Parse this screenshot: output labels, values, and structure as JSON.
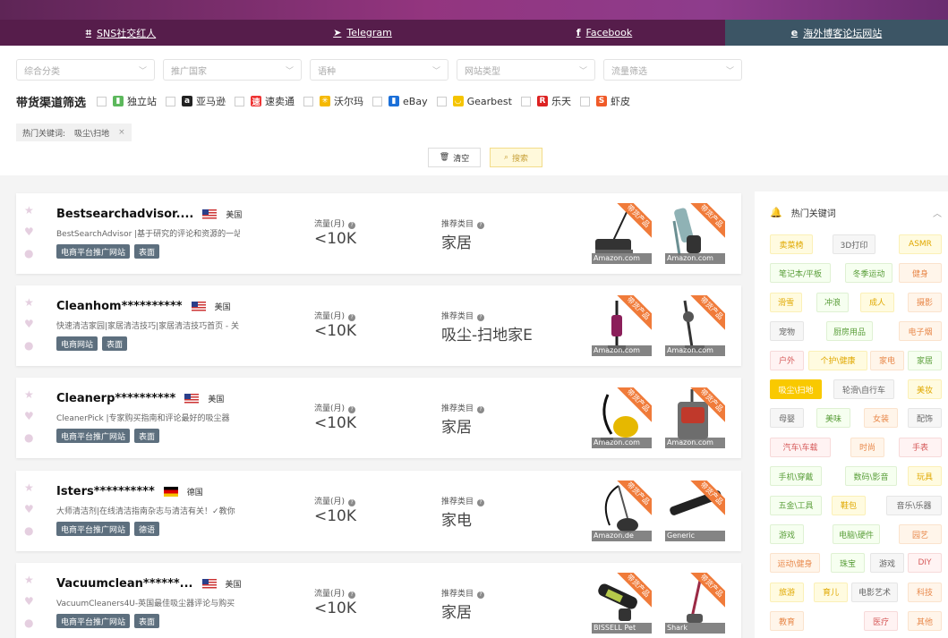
{
  "tabs": [
    {
      "label": "SNS社交红人",
      "icon": "⌗"
    },
    {
      "label": "Telegram",
      "icon": "➤"
    },
    {
      "label": "Facebook",
      "icon": "f"
    },
    {
      "label": "海外博客论坛网站",
      "icon": "e"
    }
  ],
  "filters": {
    "selects": [
      "综合分类",
      "推广国家",
      "语种",
      "网站类型",
      "流量筛选"
    ],
    "channel_label": "带货渠道筛选",
    "channels": [
      {
        "label": "独立站",
        "color": "#5cb85c",
        "glyph": "▮"
      },
      {
        "label": "亚马逊",
        "color": "#222",
        "glyph": "a"
      },
      {
        "label": "速卖通",
        "color": "#e33",
        "glyph": "速"
      },
      {
        "label": "沃尔玛",
        "color": "#f5b800",
        "glyph": "✳"
      },
      {
        "label": "eBay",
        "color": "#1b6fd8",
        "glyph": "▮"
      },
      {
        "label": "Gearbest",
        "color": "#f5c400",
        "glyph": "◡"
      },
      {
        "label": "乐天",
        "color": "#d22",
        "glyph": "R"
      },
      {
        "label": "虾皮",
        "color": "#f05a28",
        "glyph": "S"
      }
    ],
    "hot_keyword_label": "热门关键词:",
    "hot_keyword_value": "吸尘\\扫地",
    "clear_label": "清空",
    "search_label": "搜索"
  },
  "cards": [
    {
      "name": "Bestsearchadvisor....",
      "flag": "us",
      "country": "美国",
      "desc": "BestSearchAdvisor |基于研究的评论和资源的一站",
      "tags": [
        "电商平台推广网站",
        "表面"
      ],
      "traffic_label": "流量(月)",
      "traffic": "<10K",
      "category_label": "推荐类目",
      "category": "家居",
      "products": [
        {
          "src": "Amazon.com",
          "ribbon": "带货产品",
          "kind": "sweeper"
        },
        {
          "src": "Amazon.com",
          "ribbon": "带货产品",
          "kind": "handheld"
        }
      ]
    },
    {
      "name": "Cleanhom**********",
      "flag": "us",
      "country": "美国",
      "desc": "快速清洁家园|家居清洁技巧|家居清洁技巧首页 - 关",
      "tags": [
        "电商网站",
        "表面"
      ],
      "traffic_label": "流量(月)",
      "traffic": "<10K",
      "category_label": "推荐类目",
      "category": "吸尘-扫地家E",
      "products": [
        {
          "src": "Amazon.com",
          "ribbon": "带货产品",
          "kind": "stick"
        },
        {
          "src": "Amazon.com",
          "ribbon": "带货产品",
          "kind": "stick2"
        }
      ]
    },
    {
      "name": "Cleanerp**********",
      "flag": "us",
      "country": "美国",
      "desc": "CleanerPick |专家购买指南和评论最好的吸尘器",
      "tags": [
        "电商平台推广网站",
        "表面"
      ],
      "traffic_label": "流量(月)",
      "traffic": "<10K",
      "category_label": "推荐类目",
      "category": "家居",
      "products": [
        {
          "src": "Amazon.com",
          "ribbon": "带货产品",
          "kind": "canister"
        },
        {
          "src": "Amazon.com",
          "ribbon": "带货产品",
          "kind": "carpet"
        }
      ]
    },
    {
      "name": "Isters**********",
      "flag": "de",
      "country": "德国",
      "desc": "大师清洁剂|在线清洁指南杂志与清洁有关！✓教你",
      "tags": [
        "电商平台推广网站",
        "德语"
      ],
      "traffic_label": "流量(月)",
      "traffic": "<10K",
      "category_label": "推荐类目",
      "category": "家电",
      "products": [
        {
          "src": "Amazon.de",
          "ribbon": "带货产品",
          "kind": "canister2"
        },
        {
          "src": "Generic",
          "ribbon": "带货产品",
          "kind": "hose"
        }
      ]
    },
    {
      "name": "Vacuumclean******...",
      "flag": "us",
      "country": "美国",
      "desc": "VacuumCleaners4U-英国最佳吸尘器评论与购买",
      "tags": [
        "电商平台推广网站",
        "表面"
      ],
      "traffic_label": "流量(月)",
      "traffic": "<10K",
      "category_label": "推荐类目",
      "category": "家居",
      "products": [
        {
          "src": "BISSELL Pet",
          "ribbon": "带货产品",
          "kind": "hand2"
        },
        {
          "src": "Shark",
          "ribbon": "带货产品",
          "kind": "stick3"
        }
      ]
    }
  ],
  "panel": {
    "title": "热门关键词",
    "keywords": [
      {
        "label": "卖菜椅",
        "style": "y"
      },
      {
        "label": "3D打印",
        "style": "n"
      },
      {
        "label": "ASMR",
        "style": "y"
      },
      {
        "label": "笔记本/平板",
        "style": "g"
      },
      {
        "label": "冬季运动",
        "style": "g"
      },
      {
        "label": "健身",
        "style": "o"
      },
      {
        "label": "滑雪",
        "style": "y"
      },
      {
        "label": "冲浪",
        "style": "g"
      },
      {
        "label": "成人",
        "style": "y"
      },
      {
        "label": "摄影",
        "style": "o"
      },
      {
        "label": "宠物",
        "style": "n"
      },
      {
        "label": "厨房用品",
        "style": "g"
      },
      {
        "label": "电子烟",
        "style": "o"
      },
      {
        "label": "户外",
        "style": "r"
      },
      {
        "label": "个护\\健康",
        "style": "y"
      },
      {
        "label": "家电",
        "style": "o"
      },
      {
        "label": "家居",
        "style": "g"
      },
      {
        "label": "吸尘\\扫地",
        "style": "sel"
      },
      {
        "label": "轮滑\\自行车",
        "style": "n"
      },
      {
        "label": "美妆",
        "style": "y"
      },
      {
        "label": "母婴",
        "style": "n"
      },
      {
        "label": "美味",
        "style": "g"
      },
      {
        "label": "女装",
        "style": "o"
      },
      {
        "label": "配饰",
        "style": "n"
      },
      {
        "label": "汽车\\车载",
        "style": "r"
      },
      {
        "label": "时尚",
        "style": "o"
      },
      {
        "label": "手表",
        "style": "r"
      },
      {
        "label": "手机\\穿戴",
        "style": "g"
      },
      {
        "label": "数码\\影音",
        "style": "g"
      },
      {
        "label": "玩具",
        "style": "y"
      },
      {
        "label": "五金\\工具",
        "style": "g"
      },
      {
        "label": "鞋包",
        "style": "y"
      },
      {
        "label": "音乐\\乐器",
        "style": "n"
      },
      {
        "label": "游戏",
        "style": "g"
      },
      {
        "label": "电脑\\硬件",
        "style": "g"
      },
      {
        "label": "园艺",
        "style": "o"
      },
      {
        "label": "运动\\健身",
        "style": "o"
      },
      {
        "label": "珠宝",
        "style": "g"
      },
      {
        "label": "游戏",
        "style": "n"
      },
      {
        "label": "DIY",
        "style": "r"
      },
      {
        "label": "旅游",
        "style": "y"
      },
      {
        "label": "育儿",
        "style": "y"
      },
      {
        "label": "电影艺术",
        "style": "n"
      },
      {
        "label": "科技",
        "style": "o"
      },
      {
        "label": "教育",
        "style": "o"
      },
      {
        "label": "医疗",
        "style": "r"
      },
      {
        "label": "其他",
        "style": "o"
      }
    ]
  }
}
